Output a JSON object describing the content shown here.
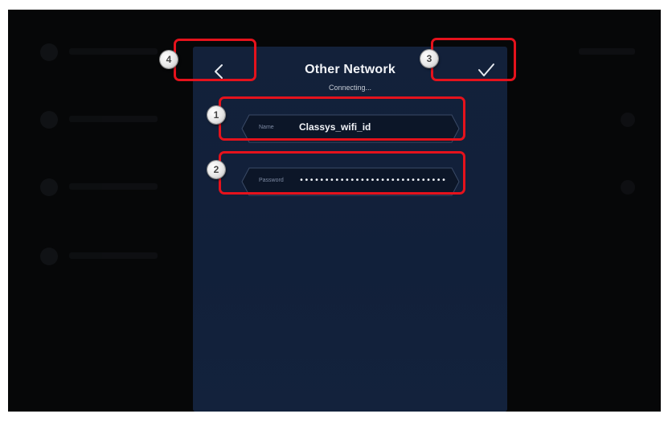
{
  "header": {
    "title": "Other Network",
    "status": "Connecting..."
  },
  "fields": {
    "name": {
      "label": "Name",
      "value": "Classys_wifi_id"
    },
    "password": {
      "label": "Password",
      "value": "•••••••••••••••••••••••••••••"
    }
  },
  "icons": {
    "back": "chevron-left-icon",
    "confirm": "check-icon"
  },
  "annotations": [
    {
      "number": "1",
      "target": "name-field"
    },
    {
      "number": "2",
      "target": "password-field"
    },
    {
      "number": "3",
      "target": "confirm-button"
    },
    {
      "number": "4",
      "target": "back-button"
    }
  ],
  "colors": {
    "panel": "#12213a",
    "highlight": "#e5121c",
    "background": "#060708"
  }
}
